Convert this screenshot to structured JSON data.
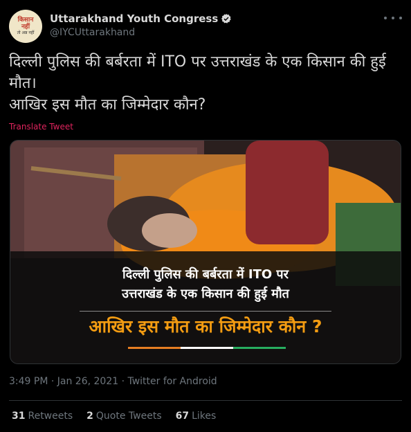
{
  "author": {
    "display_name": "Uttarakhand Youth Congress",
    "handle": "@IYCUttarakhand",
    "avatar_text_1": "किसान",
    "avatar_text_2": "नहीं",
    "avatar_text_3": "तो अन्न नहीं",
    "verified_icon": "verified-badge-icon"
  },
  "tweet": {
    "text": "दिल्ली पुलिस की बर्बरता में ITO पर उत्तराखंड के एक किसान की हुई मौत।\nआखिर इस मौत का जिम्मेदार कौन?",
    "translate_label": "Translate Tweet"
  },
  "media": {
    "overlay_line1": "दिल्ली पुलिस की बर्बरता में ITO पर\nउत्तराखंड के एक किसान की हुई मौत",
    "overlay_line2": "आखिर इस मौत का जिम्मेदार कौन ?"
  },
  "meta": {
    "timestamp": "3:49 PM · Jan 26, 2021 · Twitter for Android"
  },
  "stats": {
    "retweets_count": "31",
    "retweets_label": "Retweets",
    "quotes_count": "2",
    "quotes_label": "Quote Tweets",
    "likes_count": "67",
    "likes_label": "Likes"
  },
  "colors": {
    "background": "#000000",
    "text": "#d9d9d9",
    "secondary": "#6e767d",
    "translate": "#e0245e",
    "overlay_highlight": "#f39c12"
  }
}
